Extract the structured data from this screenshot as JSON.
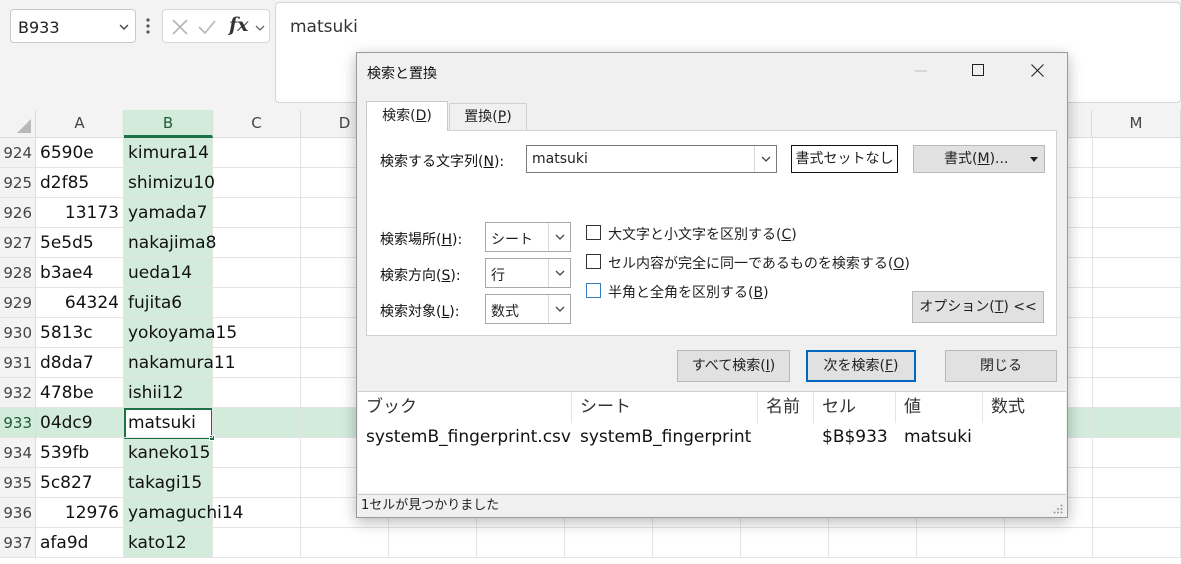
{
  "formula_bar": {
    "name_box": "B933",
    "cancel_icon": "x-icon",
    "enter_icon": "check-icon",
    "function_label": "fx",
    "formula_value": "matsuki"
  },
  "grid": {
    "columns": [
      "A",
      "B",
      "C",
      "D",
      "M"
    ],
    "selected_column": "B",
    "selected_row": "933",
    "active_cell": "B933",
    "rows": [
      {
        "num": "924",
        "a": "6590e",
        "a_numeric": false,
        "b": "kimura14"
      },
      {
        "num": "925",
        "a": "d2f85",
        "a_numeric": false,
        "b": "shimizu10"
      },
      {
        "num": "926",
        "a": "13173",
        "a_numeric": true,
        "b": "yamada7"
      },
      {
        "num": "927",
        "a": "5e5d5",
        "a_numeric": false,
        "b": "nakajima8"
      },
      {
        "num": "928",
        "a": "b3ae4",
        "a_numeric": false,
        "b": "ueda14"
      },
      {
        "num": "929",
        "a": "64324",
        "a_numeric": true,
        "b": "fujita6"
      },
      {
        "num": "930",
        "a": "5813c",
        "a_numeric": false,
        "b": "yokoyama15"
      },
      {
        "num": "931",
        "a": "d8da7",
        "a_numeric": false,
        "b": "nakamura11"
      },
      {
        "num": "932",
        "a": "478be",
        "a_numeric": false,
        "b": "ishii12"
      },
      {
        "num": "933",
        "a": "04dc9",
        "a_numeric": false,
        "b": "matsuki"
      },
      {
        "num": "934",
        "a": "539fb",
        "a_numeric": false,
        "b": "kaneko15"
      },
      {
        "num": "935",
        "a": "5c827",
        "a_numeric": false,
        "b": "takagi15"
      },
      {
        "num": "936",
        "a": "12976",
        "a_numeric": true,
        "b": "yamaguchi14"
      },
      {
        "num": "937",
        "a": "afa9d",
        "a_numeric": false,
        "b": "kato12"
      }
    ]
  },
  "dialog": {
    "title": "検索と置換",
    "tabs": {
      "find": {
        "text": "検索(",
        "key": "D",
        "close": ")"
      },
      "replace": {
        "text": "置換(",
        "key": "P",
        "close": ")"
      }
    },
    "find_what": {
      "label": "検索する文字列(",
      "key": "N",
      "close": "):",
      "value": "matsuki"
    },
    "no_format_button": "書式セットなし",
    "format_button": {
      "text": "書式(",
      "key": "M",
      "close": ")..."
    },
    "within": {
      "label": "検索場所(",
      "key": "H",
      "close": "):",
      "value": "シート"
    },
    "search": {
      "label": "検索方向(",
      "key": "S",
      "close": "):",
      "value": "行"
    },
    "look_in": {
      "label": "検索対象(",
      "key": "L",
      "close": "):",
      "value": "数式"
    },
    "options": [
      {
        "text": "大文字と小文字を区別する(",
        "key": "C",
        "close": ")",
        "checked": false
      },
      {
        "text": "セル内容が完全に同一であるものを検索する(",
        "key": "O",
        "close": ")",
        "checked": false
      },
      {
        "text": "半角と全角を区別する(",
        "key": "B",
        "close": ")",
        "checked": false
      }
    ],
    "options_button": {
      "text": "オプション(",
      "key": "T",
      "close": ") <<"
    },
    "find_all_button": {
      "text": "すべて検索(",
      "key": "I",
      "close": ")"
    },
    "find_next_button": {
      "text": "次を検索(",
      "key": "F",
      "close": ")"
    },
    "close_button": "閉じる",
    "results": {
      "headers": [
        "ブック",
        "シート",
        "名前",
        "セル",
        "値",
        "数式"
      ],
      "rows": [
        [
          "systemB_fingerprint.csv",
          "systemB_fingerprint",
          "",
          "$B$933",
          "matsuki",
          ""
        ]
      ]
    },
    "status": "1セルが見つかりました"
  }
}
